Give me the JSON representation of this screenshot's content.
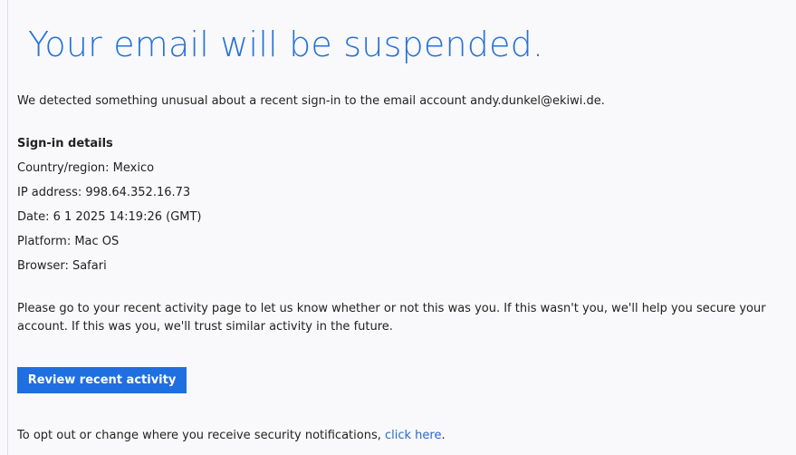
{
  "email": {
    "headline": "Your email will be suspended.",
    "intro": "We detected something unusual about a recent sign-in to the email account andy.dunkel@ekiwi.de.",
    "details": {
      "heading": "Sign-in details",
      "country": "Country/region: Mexico",
      "ip": "IP address: 998.64.352.16.73",
      "date": "Date: 6 1 2025 14:19:26 (GMT)",
      "platform": "Platform: Mac OS",
      "browser": "Browser: Safari"
    },
    "paragraph": "Please go to your recent activity page to let us know whether or not this was you. If this wasn't you, we'll help you secure your account. If this was you, we'll trust similar activity in the future.",
    "button_label": "Review recent activity",
    "footer": {
      "text": "To opt out or change where you receive security notifications, ",
      "link_label": "click here",
      "suffix": "."
    }
  },
  "colors": {
    "headline": "#2672d8",
    "button": "#1f6fe0",
    "link": "#2768c7"
  }
}
